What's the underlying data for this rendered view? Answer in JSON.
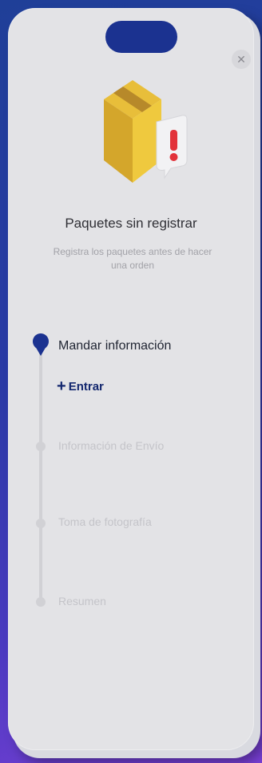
{
  "header": {
    "close_icon": "close-icon"
  },
  "hero": {
    "title": "Paquetes sin registrar",
    "subtitle": "Registra los paquetes antes de hacer una orden",
    "illustration": "package-warning-icon"
  },
  "steps": [
    {
      "label": "Mandar información",
      "state": "active",
      "action_label": "Entrar"
    },
    {
      "label": "Información de Envío",
      "state": "pending"
    },
    {
      "label": "Toma de fotografía",
      "state": "pending"
    },
    {
      "label": "Resumen",
      "state": "pending"
    }
  ],
  "colors": {
    "accent": "#1b3290",
    "background_gradient_start": "#1f3f98",
    "background_gradient_end": "#7a3fd6",
    "screen": "#e3e3e6"
  }
}
